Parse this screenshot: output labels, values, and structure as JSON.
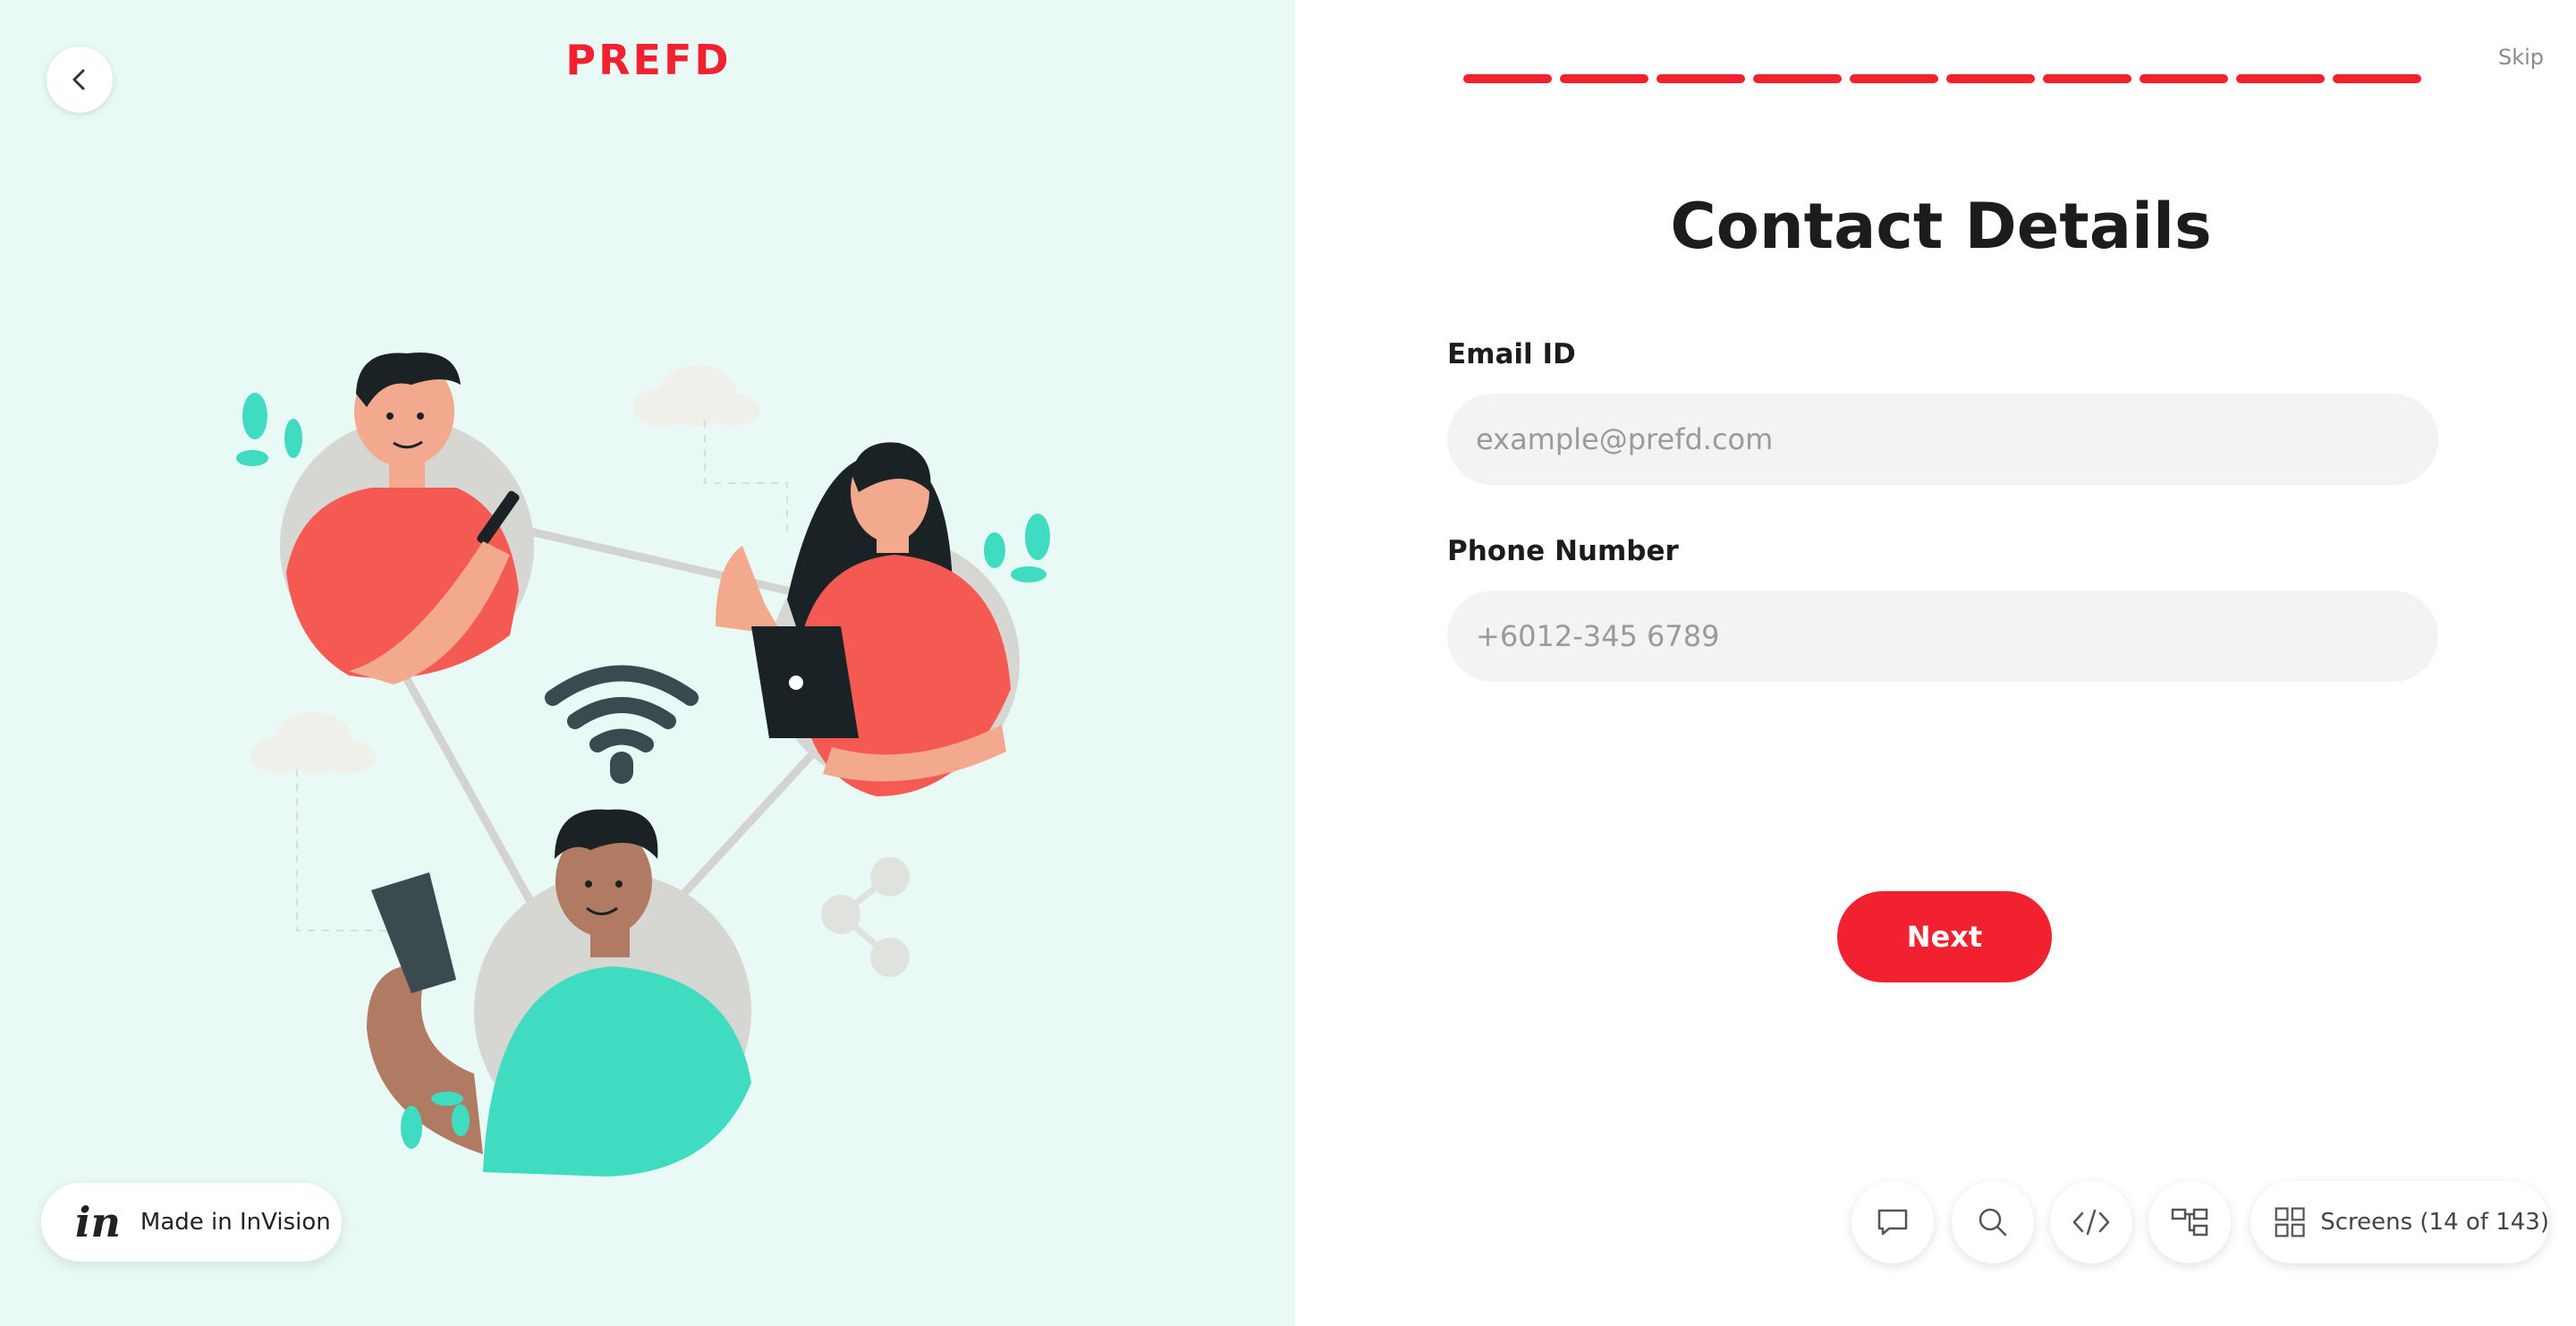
{
  "brand": {
    "logo": "PREFD",
    "accent_color": "#f2212f"
  },
  "progress": {
    "total_steps": 10,
    "completed_steps": 10
  },
  "header": {
    "skip_label": "Skip"
  },
  "form": {
    "title": "Contact Details",
    "email": {
      "label": "Email ID",
      "placeholder": "example@prefd.com",
      "value": ""
    },
    "phone": {
      "label": "Phone Number",
      "placeholder": "+6012-345 6789",
      "value": ""
    },
    "next_label": "Next"
  },
  "invision_badge": {
    "logo": "in",
    "label": "Made in InVision"
  },
  "toolbar": {
    "icons": [
      "comment-icon",
      "search-icon",
      "code-icon",
      "flow-map-icon",
      "grid-icon"
    ],
    "screens_label": "Screens (14 of 143)"
  }
}
